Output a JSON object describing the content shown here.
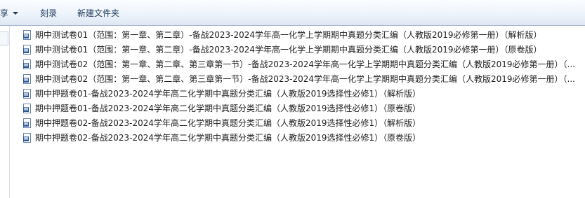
{
  "toolbar": {
    "share_label": "享",
    "burn_label": "刻录",
    "new_folder_label": "新建文件夹"
  },
  "files": [
    {
      "name": "期中测试卷01（范围：第一章、第二章）-备战2023-2024学年高一化学上学期期中真题分类汇编（人教版2019必修第一册）（解析版）",
      "icon": "word-doc-icon"
    },
    {
      "name": "期中测试卷01（范围：第一章、第二章）-备战2023-2024学年高一化学上学期期中真题分类汇编（人教版2019必修第一册）（原卷版）",
      "icon": "word-doc-icon"
    },
    {
      "name": "期中测试卷02（范围：第一章、第二章、第三章第一节）-备战2023-2024学年高一化学上学期期中真题分类汇编（人教版2019必修第一册）（...",
      "icon": "word-doc-icon"
    },
    {
      "name": "期中测试卷02（范围：第一章、第二章、第三章第一节）-备战2023-2024学年高一化学上学期期中真题分类汇编（人教版2019必修第一册）（...",
      "icon": "word-doc-icon"
    },
    {
      "name": "期中押题卷01-备战2023-2024学年高二化学期中真题分类汇编（人教版2019选择性必修1）（解析版）",
      "icon": "word-doc-icon"
    },
    {
      "name": "期中押题卷01-备战2023-2024学年高二化学期中真题分类汇编（人教版2019选择性必修1）（原卷版）",
      "icon": "word-doc-icon"
    },
    {
      "name": "期中押题卷02-备战2023-2024学年高二化学期中真题分类汇编（人教版2019选择性必修1）（解析版）",
      "icon": "word-doc-icon"
    },
    {
      "name": "期中押题卷02-备战2023-2024学年高二化学期中真题分类汇编（人教版2019选择性必修1）（原卷版）",
      "icon": "word-doc-icon"
    }
  ]
}
